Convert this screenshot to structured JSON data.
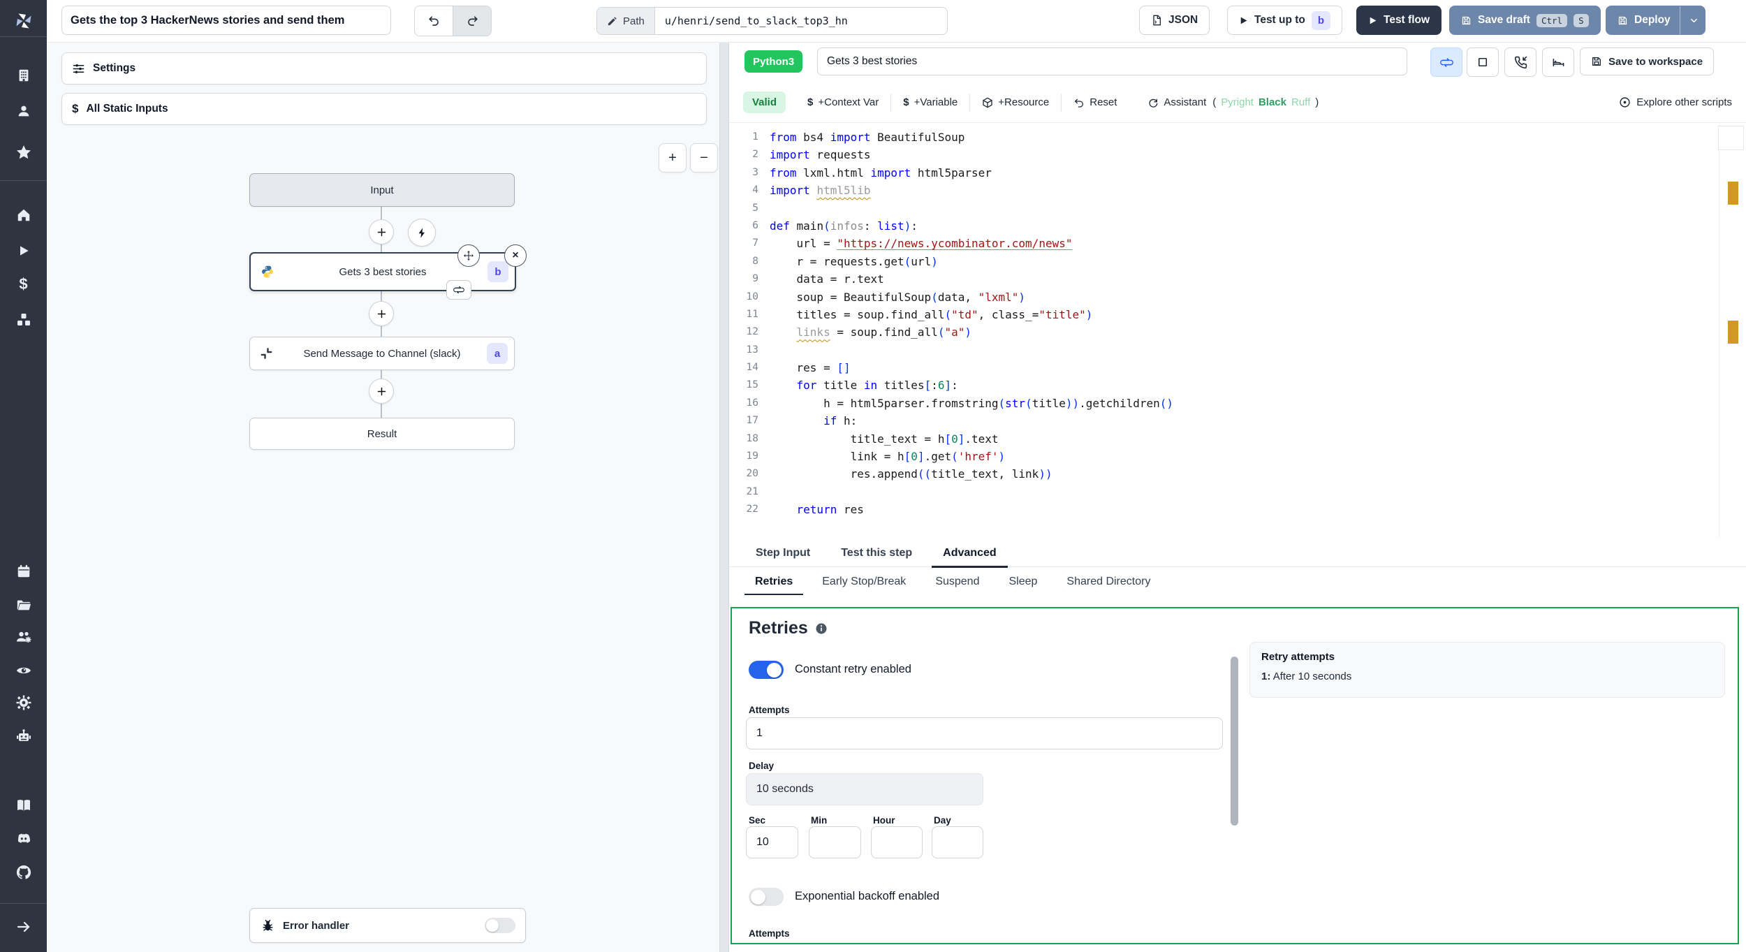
{
  "topbar": {
    "flow_title": "Gets the top 3 HackerNews stories and send them",
    "path_label": "Path",
    "path_value": "u/henri/send_to_slack_top3_hn",
    "json_button": "JSON",
    "test_up_to_label": "Test up to",
    "test_up_to_step": "b",
    "test_flow_label": "Test flow",
    "save_draft_label": "Save draft",
    "kbd_ctrl": "Ctrl",
    "kbd_s": "S",
    "deploy_label": "Deploy"
  },
  "sidebar": {
    "icons": [
      "windmill-logo",
      "workspace",
      "user",
      "favorites",
      "home",
      "runs",
      "variables",
      "resources",
      "schedules",
      "folders",
      "groups",
      "audit-logs",
      "settings",
      "workers",
      "docs",
      "discord",
      "github",
      "expand"
    ]
  },
  "flow": {
    "settings_label": "Settings",
    "all_static_inputs_label": "All Static Inputs",
    "zoom_in_label": "+",
    "zoom_out_label": "−",
    "input_node_label": "Input",
    "step_b_label": "Gets 3 best stories",
    "step_b_badge": "b",
    "step_a_label": "Send Message to Channel (slack)",
    "step_a_badge": "a",
    "result_node_label": "Result",
    "error_handler_label": "Error handler"
  },
  "editor": {
    "language_badge": "Python3",
    "step_name": "Gets 3 best stories",
    "save_to_workspace_label": "Save to workspace",
    "toolbar": {
      "valid_label": "Valid",
      "context_var_label": "+Context Var",
      "variable_label": "+Variable",
      "resource_label": "+Resource",
      "reset_label": "Reset",
      "assistant_label": "Assistant",
      "assistant_open": "(",
      "assistant_tools": [
        "Pyright",
        "Black",
        "Ruff"
      ],
      "assistant_close": ")",
      "explore_label": "Explore other scripts"
    },
    "code": {
      "lines": [
        [
          [
            "k",
            "from"
          ],
          [
            "d",
            " bs4 "
          ],
          [
            "k",
            "import"
          ],
          [
            "d",
            " BeautifulSoup"
          ]
        ],
        [
          [
            "k",
            "import"
          ],
          [
            "d",
            " requests"
          ]
        ],
        [
          [
            "k",
            "from"
          ],
          [
            "d",
            " lxml.html "
          ],
          [
            "k",
            "import"
          ],
          [
            "d",
            " html5parser"
          ]
        ],
        [
          [
            "k",
            "import"
          ],
          [
            "d",
            " "
          ],
          [
            "g",
            "html5lib"
          ]
        ],
        [],
        [
          [
            "k",
            "def"
          ],
          [
            "d",
            " main"
          ],
          [
            "b",
            "("
          ],
          [
            "m",
            "infos"
          ],
          [
            "d",
            ": "
          ],
          [
            "k",
            "list"
          ],
          [
            "b",
            ")"
          ],
          [
            "d",
            ":"
          ]
        ],
        [
          [
            "d",
            "    url = "
          ],
          [
            "u",
            "\"https://news.ycombinator.com/news\""
          ]
        ],
        [
          [
            "d",
            "    r = requests.get"
          ],
          [
            "b",
            "("
          ],
          [
            "d",
            "url"
          ],
          [
            "b",
            ")"
          ]
        ],
        [
          [
            "d",
            "    data = r.text"
          ]
        ],
        [
          [
            "d",
            "    soup = BeautifulSoup"
          ],
          [
            "b",
            "("
          ],
          [
            "d",
            "data, "
          ],
          [
            "s",
            "\"lxml\""
          ],
          [
            "b",
            ")"
          ]
        ],
        [
          [
            "d",
            "    titles = soup.find_all"
          ],
          [
            "b",
            "("
          ],
          [
            "s",
            "\"td\""
          ],
          [
            "d",
            ", class_="
          ],
          [
            "s",
            "\"title\""
          ],
          [
            "b",
            ")"
          ]
        ],
        [
          [
            "d",
            "    "
          ],
          [
            "g",
            "links"
          ],
          [
            "d",
            " = soup.find_all"
          ],
          [
            "b",
            "("
          ],
          [
            "s",
            "\"a\""
          ],
          [
            "b",
            ")"
          ]
        ],
        [],
        [
          [
            "d",
            "    res = "
          ],
          [
            "b",
            "[]"
          ]
        ],
        [
          [
            "k",
            "    for"
          ],
          [
            "d",
            " title "
          ],
          [
            "k",
            "in"
          ],
          [
            "d",
            " titles"
          ],
          [
            "b",
            "["
          ],
          [
            "d",
            ":"
          ],
          [
            "n",
            "6"
          ],
          [
            "b",
            "]"
          ],
          [
            "d",
            ":"
          ]
        ],
        [
          [
            "d",
            "        h = html5parser.fromstring"
          ],
          [
            "b",
            "("
          ],
          [
            "k",
            "str"
          ],
          [
            "b",
            "("
          ],
          [
            "d",
            "title"
          ],
          [
            "b",
            "))"
          ],
          [
            "d",
            ".getchildren"
          ],
          [
            "b",
            "()"
          ]
        ],
        [
          [
            "k",
            "        if"
          ],
          [
            "d",
            " h:"
          ]
        ],
        [
          [
            "d",
            "            title_text = h"
          ],
          [
            "b",
            "["
          ],
          [
            "n",
            "0"
          ],
          [
            "b",
            "]"
          ],
          [
            "d",
            ".text"
          ]
        ],
        [
          [
            "d",
            "            link = h"
          ],
          [
            "b",
            "["
          ],
          [
            "n",
            "0"
          ],
          [
            "b",
            "]"
          ],
          [
            "d",
            ".get"
          ],
          [
            "b",
            "("
          ],
          [
            "s",
            "'href'"
          ],
          [
            "b",
            ")"
          ]
        ],
        [
          [
            "d",
            "            res.append"
          ],
          [
            "b",
            "(("
          ],
          [
            "d",
            "title_text, link"
          ],
          [
            "b",
            "))"
          ]
        ],
        [],
        [
          [
            "k",
            "    return"
          ],
          [
            "d",
            " res"
          ]
        ]
      ]
    }
  },
  "tabs": {
    "primary": [
      "Step Input",
      "Test this step",
      "Advanced"
    ],
    "primary_active": "Advanced",
    "secondary": [
      "Retries",
      "Early Stop/Break",
      "Suspend",
      "Sleep",
      "Shared Directory"
    ],
    "secondary_active": "Retries"
  },
  "retries": {
    "title": "Retries",
    "constant_retry_label": "Constant retry enabled",
    "attempts_label": "Attempts",
    "attempts_value": "1",
    "delay_label": "Delay",
    "delay_value": "10 seconds",
    "unit_labels": [
      "Sec",
      "Min",
      "Hour",
      "Day"
    ],
    "sec_value": "10",
    "min_value": "",
    "hour_value": "",
    "day_value": "",
    "exponential_backoff_label": "Exponential backoff enabled",
    "attempts_bottom_label": "Attempts",
    "summary_title": "Retry attempts",
    "summary_item_index": "1:",
    "summary_item_text": "After 10 seconds"
  },
  "colors": {
    "sidebar_bg": "#2e3440",
    "steel_blue_button": "#6d87ab",
    "dark_button": "#2b3648",
    "green_badge": "#22c55e",
    "valid_green_text": "#15803d",
    "panel_border_green": "#16a34a",
    "toggle_on_blue": "#2563eb",
    "indigo_badge_text": "#4f46e5",
    "warning_marker": "#d29922"
  }
}
